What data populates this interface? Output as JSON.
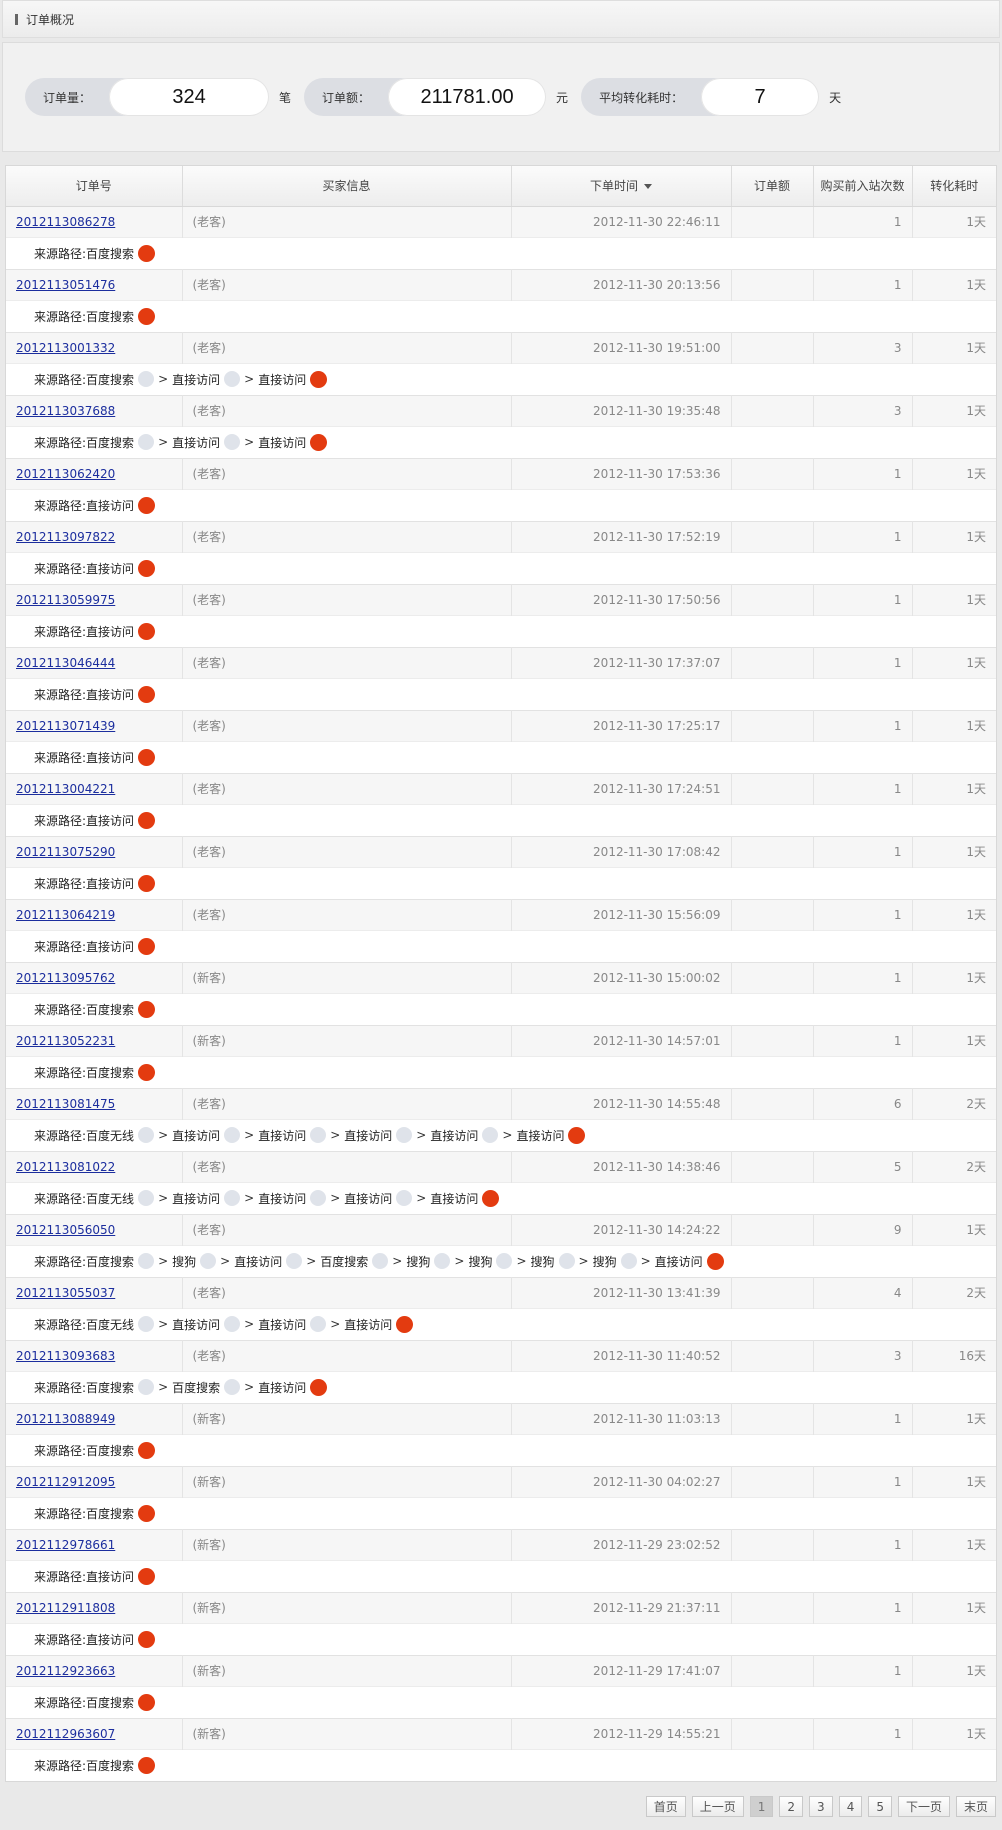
{
  "header": {
    "title": "订单概况"
  },
  "summary": {
    "orders": {
      "label": "订单量：",
      "value": "324",
      "unit": "笔"
    },
    "amount": {
      "label": "订单额：",
      "value": "211781.00",
      "unit": "元"
    },
    "avg_time": {
      "label": "平均转化耗时：",
      "value": "7",
      "unit": "天"
    }
  },
  "table": {
    "columns": [
      "订单号",
      "买家信息",
      "下单时间",
      "订单额",
      "购买前入站次数",
      "转化耗时"
    ],
    "sorted_column": "下单时间",
    "path_prefix": "来源路径:",
    "path_separator": ">",
    "rows": [
      {
        "id": "2012113086278",
        "buyer": "(老客)",
        "time": "2012-11-30 22:46:11",
        "amount": "",
        "visits": "1",
        "duration": "1天",
        "path": [
          "百度搜索"
        ]
      },
      {
        "id": "2012113051476",
        "buyer": "(老客)",
        "time": "2012-11-30 20:13:56",
        "amount": "",
        "visits": "1",
        "duration": "1天",
        "path": [
          "百度搜索"
        ]
      },
      {
        "id": "2012113001332",
        "buyer": "(老客)",
        "time": "2012-11-30 19:51:00",
        "amount": "",
        "visits": "3",
        "duration": "1天",
        "path": [
          "百度搜索",
          "直接访问",
          "直接访问"
        ]
      },
      {
        "id": "2012113037688",
        "buyer": "(老客)",
        "time": "2012-11-30 19:35:48",
        "amount": "",
        "visits": "3",
        "duration": "1天",
        "path": [
          "百度搜索",
          "直接访问",
          "直接访问"
        ]
      },
      {
        "id": "2012113062420",
        "buyer": "(老客)",
        "time": "2012-11-30 17:53:36",
        "amount": "",
        "visits": "1",
        "duration": "1天",
        "path": [
          "直接访问"
        ]
      },
      {
        "id": "2012113097822",
        "buyer": "(老客)",
        "time": "2012-11-30 17:52:19",
        "amount": "",
        "visits": "1",
        "duration": "1天",
        "path": [
          "直接访问"
        ]
      },
      {
        "id": "2012113059975",
        "buyer": "(老客)",
        "time": "2012-11-30 17:50:56",
        "amount": "",
        "visits": "1",
        "duration": "1天",
        "path": [
          "直接访问"
        ]
      },
      {
        "id": "2012113046444",
        "buyer": "(老客)",
        "time": "2012-11-30 17:37:07",
        "amount": "",
        "visits": "1",
        "duration": "1天",
        "path": [
          "直接访问"
        ]
      },
      {
        "id": "2012113071439",
        "buyer": "(老客)",
        "time": "2012-11-30 17:25:17",
        "amount": "",
        "visits": "1",
        "duration": "1天",
        "path": [
          "直接访问"
        ]
      },
      {
        "id": "2012113004221",
        "buyer": "(老客)",
        "time": "2012-11-30 17:24:51",
        "amount": "",
        "visits": "1",
        "duration": "1天",
        "path": [
          "直接访问"
        ]
      },
      {
        "id": "2012113075290",
        "buyer": "(老客)",
        "time": "2012-11-30 17:08:42",
        "amount": "",
        "visits": "1",
        "duration": "1天",
        "path": [
          "直接访问"
        ]
      },
      {
        "id": "2012113064219",
        "buyer": "(老客)",
        "time": "2012-11-30 15:56:09",
        "amount": "",
        "visits": "1",
        "duration": "1天",
        "path": [
          "直接访问"
        ]
      },
      {
        "id": "2012113095762",
        "buyer": "(新客)",
        "time": "2012-11-30 15:00:02",
        "amount": "",
        "visits": "1",
        "duration": "1天",
        "path": [
          "百度搜索"
        ]
      },
      {
        "id": "2012113052231",
        "buyer": "(新客)",
        "time": "2012-11-30 14:57:01",
        "amount": "",
        "visits": "1",
        "duration": "1天",
        "path": [
          "百度搜索"
        ]
      },
      {
        "id": "2012113081475",
        "buyer": "(老客)",
        "time": "2012-11-30 14:55:48",
        "amount": "",
        "visits": "6",
        "duration": "2天",
        "path": [
          "百度无线",
          "直接访问",
          "直接访问",
          "直接访问",
          "直接访问",
          "直接访问"
        ]
      },
      {
        "id": "2012113081022",
        "buyer": "(老客)",
        "time": "2012-11-30 14:38:46",
        "amount": "",
        "visits": "5",
        "duration": "2天",
        "path": [
          "百度无线",
          "直接访问",
          "直接访问",
          "直接访问",
          "直接访问"
        ]
      },
      {
        "id": "2012113056050",
        "buyer": "(老客)",
        "time": "2012-11-30 14:24:22",
        "amount": "",
        "visits": "9",
        "duration": "1天",
        "path": [
          "百度搜索",
          "搜狗",
          "直接访问",
          "百度搜索",
          "搜狗",
          "搜狗",
          "搜狗",
          "搜狗",
          "直接访问"
        ]
      },
      {
        "id": "2012113055037",
        "buyer": "(老客)",
        "time": "2012-11-30 13:41:39",
        "amount": "",
        "visits": "4",
        "duration": "2天",
        "path": [
          "百度无线",
          "直接访问",
          "直接访问",
          "直接访问"
        ]
      },
      {
        "id": "2012113093683",
        "buyer": "(老客)",
        "time": "2012-11-30 11:40:52",
        "amount": "",
        "visits": "3",
        "duration": "16天",
        "path": [
          "百度搜索",
          "百度搜索",
          "直接访问"
        ]
      },
      {
        "id": "2012113088949",
        "buyer": "(新客)",
        "time": "2012-11-30 11:03:13",
        "amount": "",
        "visits": "1",
        "duration": "1天",
        "path": [
          "百度搜索"
        ]
      },
      {
        "id": "2012112912095",
        "buyer": "(新客)",
        "time": "2012-11-30 04:02:27",
        "amount": "",
        "visits": "1",
        "duration": "1天",
        "path": [
          "百度搜索"
        ]
      },
      {
        "id": "2012112978661",
        "buyer": "(新客)",
        "time": "2012-11-29 23:02:52",
        "amount": "",
        "visits": "1",
        "duration": "1天",
        "path": [
          "直接访问"
        ]
      },
      {
        "id": "2012112911808",
        "buyer": "(新客)",
        "time": "2012-11-29 21:37:11",
        "amount": "",
        "visits": "1",
        "duration": "1天",
        "path": [
          "直接访问"
        ]
      },
      {
        "id": "2012112923663",
        "buyer": "(新客)",
        "time": "2012-11-29 17:41:07",
        "amount": "",
        "visits": "1",
        "duration": "1天",
        "path": [
          "百度搜索"
        ]
      },
      {
        "id": "2012112963607",
        "buyer": "(新客)",
        "time": "2012-11-29 14:55:21",
        "amount": "",
        "visits": "1",
        "duration": "1天",
        "path": [
          "百度搜索"
        ]
      }
    ]
  },
  "pager": {
    "first": "首页",
    "prev": "上一页",
    "pages": [
      "1",
      "2",
      "3",
      "4",
      "5"
    ],
    "current": "1",
    "next": "下一页",
    "last": "末页"
  },
  "colors": {
    "link": "#1c2e9e",
    "final_step_dot": "#e33b10",
    "step_dot": "#dfe3ea"
  }
}
